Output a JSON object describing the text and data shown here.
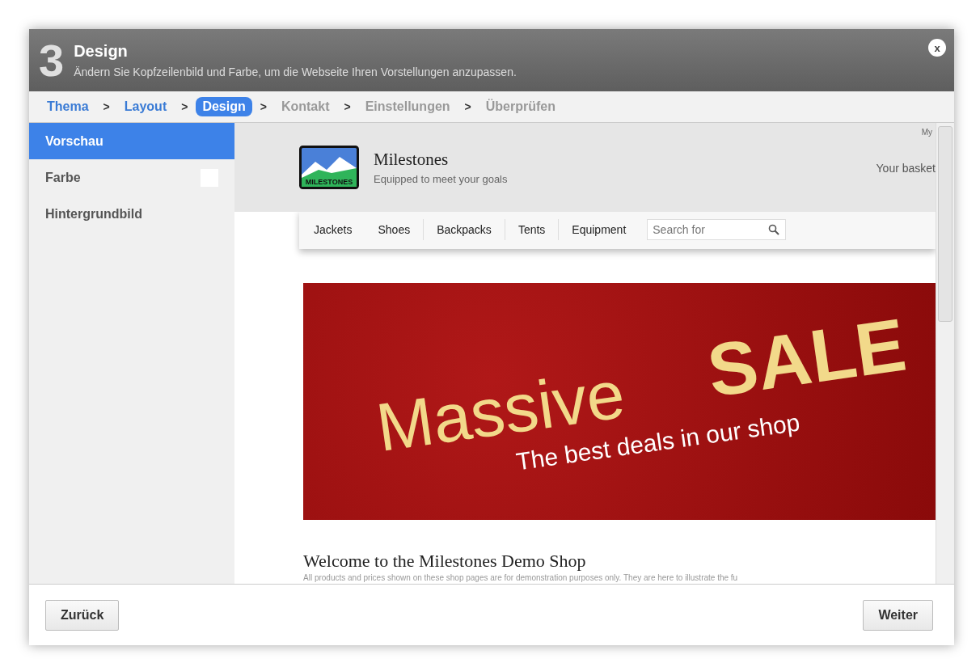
{
  "dialog": {
    "step_number": "3",
    "title": "Design",
    "subtitle": "Ändern Sie Kopfzeilenbild und Farbe, um die Webseite Ihren Vorstellungen anzupassen.",
    "close": "x"
  },
  "steps": [
    {
      "label": "Thema",
      "done": true,
      "selected": false
    },
    {
      "label": "Layout",
      "done": true,
      "selected": false
    },
    {
      "label": "Design",
      "done": true,
      "selected": true
    },
    {
      "label": "Kontakt",
      "done": false,
      "selected": false
    },
    {
      "label": "Einstellungen",
      "done": false,
      "selected": false
    },
    {
      "label": "Überprüfen",
      "done": false,
      "selected": false
    }
  ],
  "step_separator": ">",
  "sidebar": {
    "items": [
      {
        "label": "Vorschau",
        "selected": true
      },
      {
        "label": "Farbe",
        "selected": false,
        "color": "#ffffff"
      },
      {
        "label": "Hintergrundbild",
        "selected": false
      }
    ]
  },
  "preview": {
    "top_link": "My",
    "shop_name": "Milestones",
    "tagline": "Equipped to meet your goals",
    "logo_text": "MILESTONES",
    "basket": "Your basket",
    "nav": [
      "Jackets",
      "Shoes",
      "Backpacks",
      "Tents",
      "Equipment"
    ],
    "search": {
      "placeholder": "Search for"
    },
    "banner": {
      "line1": "Massive",
      "line2": "SALE",
      "line3": "The best deals in our shop"
    },
    "welcome_title": "Welcome to the Milestones Demo Shop",
    "welcome_text": "All products and prices shown on these shop pages are for demonstration purposes only. They are here to illustrate the fu"
  },
  "buttons": {
    "back": "Zurück",
    "next": "Weiter"
  }
}
